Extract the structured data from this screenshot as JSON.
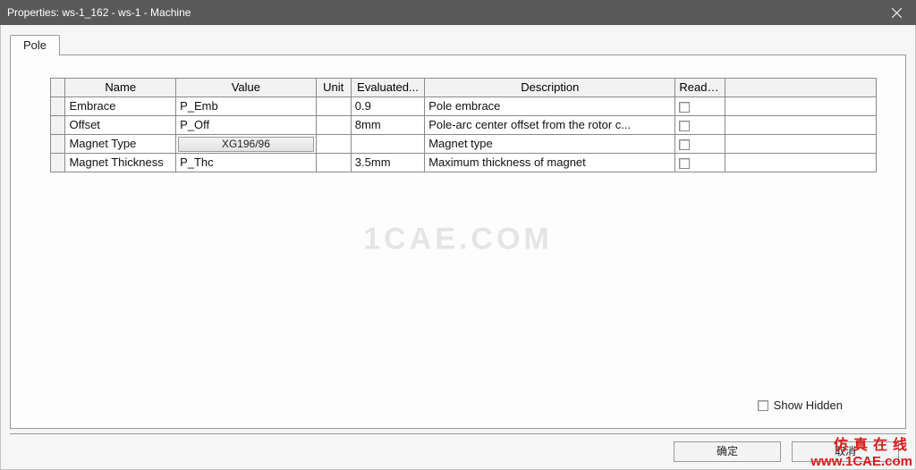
{
  "window": {
    "title": "Properties: ws-1_162 - ws-1 - Machine",
    "close_icon": "close"
  },
  "tabs": [
    {
      "label": "Pole",
      "active": true
    }
  ],
  "grid": {
    "columns": {
      "rowHandle": "",
      "name": "Name",
      "value": "Value",
      "unit": "Unit",
      "evaluated": "Evaluated...",
      "description": "Description",
      "readonly": "Read-o...",
      "extra": ""
    },
    "rows": [
      {
        "name": "Embrace",
        "value": "P_Emb",
        "value_is_button": false,
        "unit": "",
        "evaluated": "0.9",
        "description": "Pole embrace",
        "readonly": false
      },
      {
        "name": "Offset",
        "value": "P_Off",
        "value_is_button": false,
        "unit": "",
        "evaluated": "8mm",
        "description": "Pole-arc center offset from the rotor c...",
        "readonly": false
      },
      {
        "name": "Magnet Type",
        "value": "XG196/96",
        "value_is_button": true,
        "unit": "",
        "evaluated": "",
        "description": "Magnet type",
        "readonly": false
      },
      {
        "name": "Magnet Thickness",
        "value": "P_Thc",
        "value_is_button": false,
        "unit": "",
        "evaluated": "3.5mm",
        "description": "Maximum thickness of magnet",
        "readonly": false
      }
    ]
  },
  "showHidden": {
    "label": "Show Hidden",
    "checked": false
  },
  "buttons": {
    "ok": "确定",
    "cancel": "取消"
  },
  "watermark": {
    "center": "1CAE.COM",
    "cn": "仿真在线",
    "url": "www.1CAE.com"
  },
  "columnWidths": {
    "rowHandle": 16,
    "name": 120,
    "value": 152,
    "unit": 38,
    "evaluated": 80,
    "description": 272,
    "readonly": 54,
    "extra": 164
  }
}
